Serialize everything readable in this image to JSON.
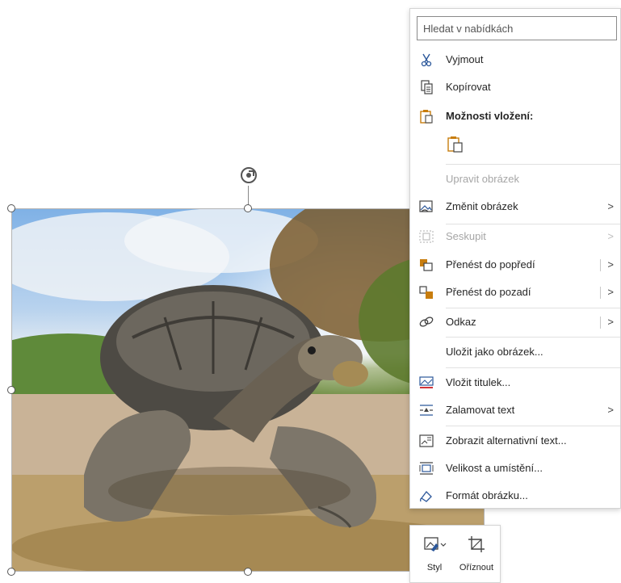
{
  "context_menu": {
    "search_placeholder": "Hledat v nabídkách",
    "items": {
      "cut": "Vyjmout",
      "copy": "Kopírovat",
      "paste_options": "Možnosti vložení:",
      "edit_picture": "Upravit obrázek",
      "change_picture": "Změnit obrázek",
      "group": "Seskupit",
      "bring_forward": "Přenést do popředí",
      "send_backward": "Přenést do pozadí",
      "link": "Odkaz",
      "save_as_picture": "Uložit jako obrázek...",
      "insert_caption": "Vložit titulek...",
      "wrap_text": "Zalamovat text",
      "view_alt_text": "Zobrazit alternativní text...",
      "size_and_position": "Velikost a umístění...",
      "format_picture": "Formát obrázku..."
    },
    "submenu_arrow": ">"
  },
  "mini_toolbar": {
    "style_label": "Styl",
    "crop_label": "Oříznout"
  },
  "icons": {
    "cut": "scissors-icon",
    "copy": "copy-icon",
    "paste": "clipboard-icon",
    "change_picture": "change-picture-icon",
    "group": "group-icon",
    "bring_forward": "bring-forward-icon",
    "send_backward": "send-backward-icon",
    "link": "link-icon",
    "insert_caption": "caption-icon",
    "wrap_text": "wrap-text-icon",
    "alt_text": "alt-text-icon",
    "size_position": "size-position-icon",
    "format_picture": "format-picture-icon",
    "rotate": "rotate-icon",
    "style": "picture-style-icon",
    "crop": "crop-icon"
  },
  "colors": {
    "accent_blue": "#2b579a",
    "paste_orange": "#c87d0e",
    "caption_red": "#d13438"
  }
}
